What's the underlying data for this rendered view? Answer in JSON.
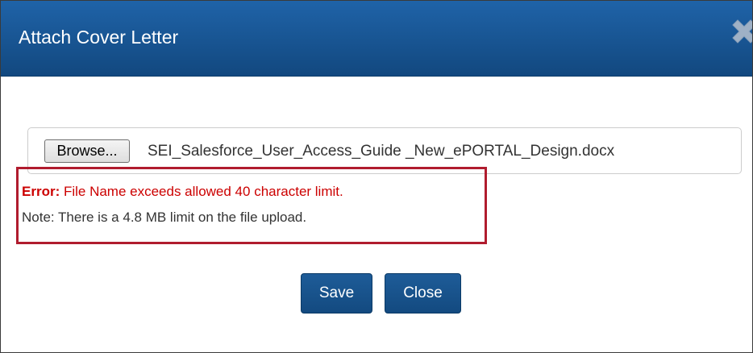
{
  "dialog": {
    "title": "Attach Cover Letter",
    "close_icon": "close-x-icon"
  },
  "file_input": {
    "browse_label": "Browse...",
    "file_name": "SEI_Salesforce_User_Access_Guide _New_ePORTAL_Design.docx"
  },
  "messages": {
    "error_label": "Error:",
    "error_text": " File Name exceeds allowed 40 character limit.",
    "note_text": "Note: There is a 4.8 MB limit on the file upload."
  },
  "actions": {
    "save_label": "Save",
    "close_label": "Close"
  },
  "colors": {
    "header_bg": "#17589a",
    "button_bg": "#18528c",
    "error_text": "#cc0000",
    "highlight_border": "#b01c2e"
  }
}
